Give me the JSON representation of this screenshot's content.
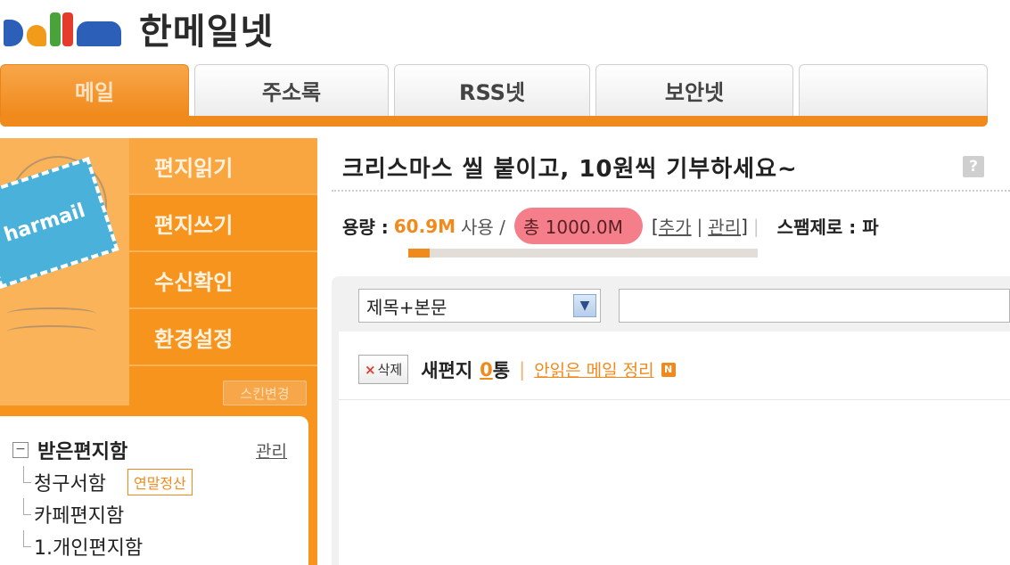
{
  "brand": {
    "title": "한메일넷"
  },
  "tabs": [
    {
      "label": "메일",
      "active": true
    },
    {
      "label": "주소록"
    },
    {
      "label": "RSS넷"
    },
    {
      "label": "보안넷"
    },
    {
      "label": ""
    }
  ],
  "sidebar": {
    "stamp_text": "harmail",
    "menu": [
      {
        "label": "편지읽기"
      },
      {
        "label": "편지쓰기"
      },
      {
        "label": "수신확인"
      },
      {
        "label": "환경설정"
      }
    ],
    "skin_button": "스킨변경",
    "folder": {
      "title": "받은편지함",
      "toggle": "−",
      "manage": "관리",
      "items": [
        {
          "label": "청구서함",
          "badge": "연말정산"
        },
        {
          "label": "카페편지함"
        },
        {
          "label": "1.개인편지함"
        }
      ]
    }
  },
  "main": {
    "headline": "크리스마스 씰 붙이고, 10원씩 기부하세요~",
    "help": "?",
    "usage": {
      "label": "용량 :",
      "used": "60.9M",
      "used_suffix": "사용 /",
      "total": "총 1000.0M",
      "add": "추가",
      "manage": "관리",
      "spam_label": "스팸제로 : 파",
      "fraction": 0.061
    },
    "search": {
      "option": "제목+본문",
      "arrow": "▼",
      "query": ""
    },
    "list": {
      "delete": "삭제",
      "delete_x": "×",
      "new_label": "새편지",
      "new_count": "0",
      "new_unit": "통",
      "unread_link": "안읽은 메일 정리",
      "n_badge": "N"
    }
  },
  "colors": {
    "accent": "#f08a1c",
    "stamp": "#4ab1da",
    "highlight": "#f47f8a"
  }
}
